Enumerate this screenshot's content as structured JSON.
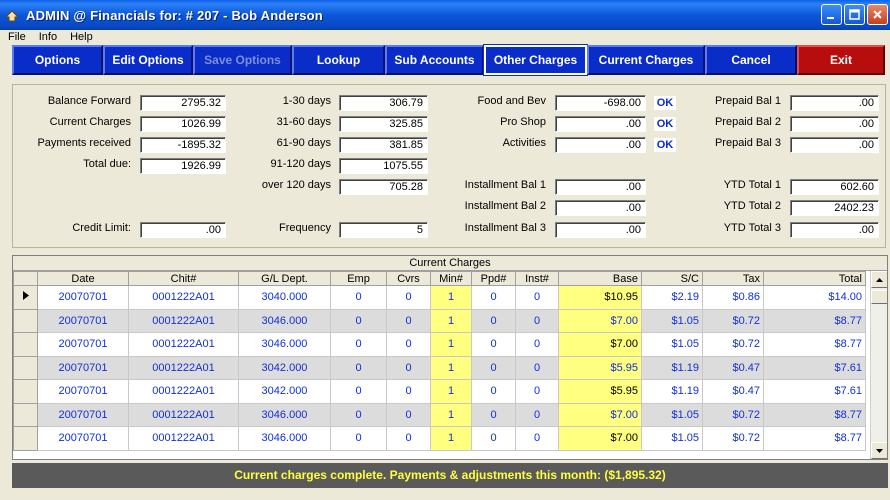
{
  "window": {
    "title": "ADMIN @ Financials for:  # 207 - Bob Anderson"
  },
  "menu": [
    "File",
    "Info",
    "Help"
  ],
  "toolbar": [
    {
      "label": "Options",
      "state": "normal"
    },
    {
      "label": "Edit Options",
      "state": "normal"
    },
    {
      "label": "Save Options",
      "state": "disabled"
    },
    {
      "label": "Lookup",
      "state": "normal"
    },
    {
      "label": "Sub Accounts",
      "state": "normal"
    },
    {
      "label": "Other Charges",
      "state": "active"
    },
    {
      "label": "Current Charges",
      "state": "normal"
    },
    {
      "label": "Cancel",
      "state": "normal"
    },
    {
      "label": "Exit",
      "state": "exit"
    }
  ],
  "balances": {
    "balance_forward": {
      "label": "Balance Forward",
      "value": "2795.32"
    },
    "current_charges": {
      "label": "Current Charges",
      "value": "1026.99"
    },
    "payments_received": {
      "label": "Payments received",
      "value": "-1895.32"
    },
    "total_due": {
      "label": "Total due:",
      "value": "1926.99"
    },
    "credit_limit": {
      "label": "Credit Limit:",
      "value": ".00"
    }
  },
  "aging": {
    "d1_30": {
      "label": "1-30 days",
      "value": "306.79"
    },
    "d31_60": {
      "label": "31-60 days",
      "value": "325.85"
    },
    "d61_90": {
      "label": "61-90 days",
      "value": "381.85"
    },
    "d91_120": {
      "label": "91-120 days",
      "value": "1075.55"
    },
    "over_120": {
      "label": "over 120 days",
      "value": "705.28"
    },
    "frequency": {
      "label": "Frequency",
      "value": "5"
    }
  },
  "minimums": {
    "food_bev": {
      "label": "Food and Bev",
      "value": "-698.00",
      "ok": "OK"
    },
    "pro_shop": {
      "label": "Pro Shop",
      "value": ".00",
      "ok": "OK"
    },
    "activities": {
      "label": "Activities",
      "value": ".00",
      "ok": "OK"
    },
    "inst_bal_1": {
      "label": "Installment Bal 1",
      "value": ".00"
    },
    "inst_bal_2": {
      "label": "Installment Bal 2",
      "value": ".00"
    },
    "inst_bal_3": {
      "label": "Installment Bal 3",
      "value": ".00"
    }
  },
  "prepaid": {
    "bal_1": {
      "label": "Prepaid Bal 1",
      "value": ".00"
    },
    "bal_2": {
      "label": "Prepaid Bal 2",
      "value": ".00"
    },
    "bal_3": {
      "label": "Prepaid Bal 3",
      "value": ".00"
    },
    "ytd_1": {
      "label": "YTD Total 1",
      "value": "602.60"
    },
    "ytd_2": {
      "label": "YTD Total 2",
      "value": "2402.23"
    },
    "ytd_3": {
      "label": "YTD Total 3",
      "value": ".00"
    }
  },
  "grid": {
    "caption": "Current Charges",
    "columns": [
      "Date",
      "Chit#",
      "G/L Dept.",
      "Emp",
      "Cvrs",
      "Min#",
      "Ppd#",
      "Inst#",
      "Base",
      "S/C",
      "Tax",
      "Total"
    ],
    "rows": [
      [
        "20070701",
        "0001222A01",
        "3040.000",
        "0",
        "0",
        "1",
        "0",
        "0",
        "$10.95",
        "$2.19",
        "$0.86",
        "$14.00"
      ],
      [
        "20070701",
        "0001222A01",
        "3046.000",
        "0",
        "0",
        "1",
        "0",
        "0",
        "$7.00",
        "$1.05",
        "$0.72",
        "$8.77"
      ],
      [
        "20070701",
        "0001222A01",
        "3046.000",
        "0",
        "0",
        "1",
        "0",
        "0",
        "$7.00",
        "$1.05",
        "$0.72",
        "$8.77"
      ],
      [
        "20070701",
        "0001222A01",
        "3042.000",
        "0",
        "0",
        "1",
        "0",
        "0",
        "$5.95",
        "$1.19",
        "$0.47",
        "$7.61"
      ],
      [
        "20070701",
        "0001222A01",
        "3042.000",
        "0",
        "0",
        "1",
        "0",
        "0",
        "$5.95",
        "$1.19",
        "$0.47",
        "$7.61"
      ],
      [
        "20070701",
        "0001222A01",
        "3046.000",
        "0",
        "0",
        "1",
        "0",
        "0",
        "$7.00",
        "$1.05",
        "$0.72",
        "$8.77"
      ],
      [
        "20070701",
        "0001222A01",
        "3046.000",
        "0",
        "0",
        "1",
        "0",
        "0",
        "$7.00",
        "$1.05",
        "$0.72",
        "$8.77"
      ]
    ]
  },
  "status": "Current charges complete.  Payments & adjustments this month: ($1,895.32)"
}
